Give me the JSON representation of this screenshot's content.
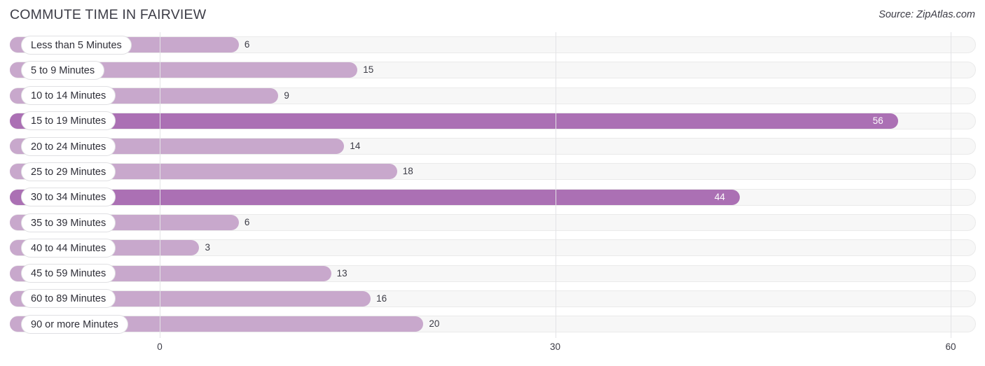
{
  "header": {
    "title": "COMMUTE TIME IN FAIRVIEW",
    "source": "Source: ZipAtlas.com"
  },
  "colors": {
    "bar_light": "#c8a8cc",
    "bar_dark": "#ab70b4",
    "track": "#f7f7f7",
    "gridline": "#e3e3e6",
    "text": "#3c3c46",
    "value_inside": "#ffffff"
  },
  "axis": {
    "ticks": [
      {
        "label": "0",
        "value": 0
      },
      {
        "label": "30",
        "value": 30
      },
      {
        "label": "60",
        "value": 60
      }
    ],
    "min": 0,
    "max": 60
  },
  "chart_data": {
    "type": "bar",
    "orientation": "horizontal",
    "title": "COMMUTE TIME IN FAIRVIEW",
    "subtitle": "",
    "xlabel": "",
    "ylabel": "",
    "xlim": [
      0,
      60
    ],
    "grid": true,
    "legend": null,
    "categories": [
      "Less than 5 Minutes",
      "5 to 9 Minutes",
      "10 to 14 Minutes",
      "15 to 19 Minutes",
      "20 to 24 Minutes",
      "25 to 29 Minutes",
      "30 to 34 Minutes",
      "35 to 39 Minutes",
      "40 to 44 Minutes",
      "45 to 59 Minutes",
      "60 to 89 Minutes",
      "90 or more Minutes"
    ],
    "values": [
      6,
      15,
      9,
      56,
      14,
      18,
      44,
      6,
      3,
      13,
      16,
      20
    ],
    "value_labels": [
      "6",
      "15",
      "9",
      "56",
      "14",
      "18",
      "44",
      "6",
      "3",
      "13",
      "16",
      "20"
    ]
  },
  "rows": [
    {
      "label": "Less than 5 Minutes",
      "value": 6,
      "value_label": "6",
      "highlight": false,
      "label_inside": false
    },
    {
      "label": "5 to 9 Minutes",
      "value": 15,
      "value_label": "15",
      "highlight": false,
      "label_inside": false
    },
    {
      "label": "10 to 14 Minutes",
      "value": 9,
      "value_label": "9",
      "highlight": false,
      "label_inside": false
    },
    {
      "label": "15 to 19 Minutes",
      "value": 56,
      "value_label": "56",
      "highlight": true,
      "label_inside": true
    },
    {
      "label": "20 to 24 Minutes",
      "value": 14,
      "value_label": "14",
      "highlight": false,
      "label_inside": false
    },
    {
      "label": "25 to 29 Minutes",
      "value": 18,
      "value_label": "18",
      "highlight": false,
      "label_inside": false
    },
    {
      "label": "30 to 34 Minutes",
      "value": 44,
      "value_label": "44",
      "highlight": true,
      "label_inside": true
    },
    {
      "label": "35 to 39 Minutes",
      "value": 6,
      "value_label": "6",
      "highlight": false,
      "label_inside": false
    },
    {
      "label": "40 to 44 Minutes",
      "value": 3,
      "value_label": "3",
      "highlight": false,
      "label_inside": false
    },
    {
      "label": "45 to 59 Minutes",
      "value": 13,
      "value_label": "13",
      "highlight": false,
      "label_inside": false
    },
    {
      "label": "60 to 89 Minutes",
      "value": 16,
      "value_label": "16",
      "highlight": false,
      "label_inside": false
    },
    {
      "label": "90 or more Minutes",
      "value": 20,
      "value_label": "20",
      "highlight": false,
      "label_inside": false
    }
  ]
}
